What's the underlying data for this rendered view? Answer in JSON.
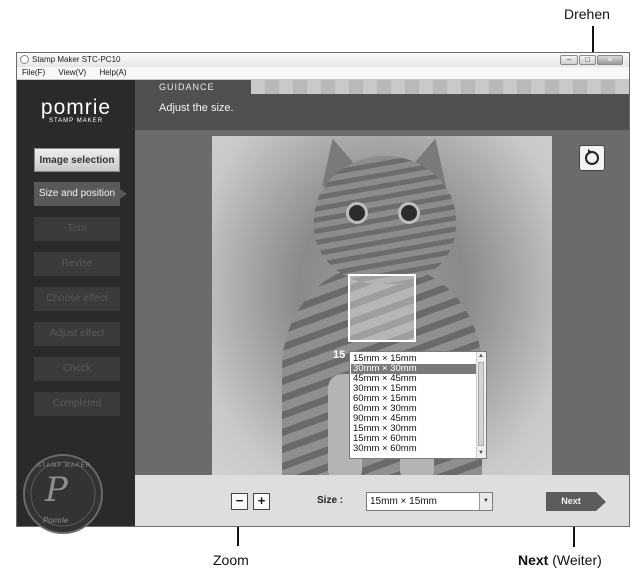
{
  "callouts": {
    "drehen": "Drehen",
    "zoom": "Zoom",
    "next_bold": "Next",
    "next_suffix": " (Weiter)"
  },
  "window": {
    "title": "Stamp Maker STC-PC10",
    "controls": [
      "–",
      "□",
      "×"
    ]
  },
  "menu": [
    "File(F)",
    "View(V)",
    "Help(A)"
  ],
  "logo": {
    "brand": "pomrie",
    "sub": "STAMP MAKER"
  },
  "steps": [
    {
      "label": "Image selection",
      "state": "done"
    },
    {
      "label": "Size and position",
      "state": "active"
    },
    {
      "label": "Trim",
      "state": "disabled"
    },
    {
      "label": "Revise",
      "state": "disabled"
    },
    {
      "label": "Choose effect",
      "state": "disabled"
    },
    {
      "label": "Adjust effect",
      "state": "disabled"
    },
    {
      "label": "Check",
      "state": "disabled"
    },
    {
      "label": "Completed",
      "state": "disabled"
    }
  ],
  "seal": {
    "top_text": "STAMP MAKER",
    "letter": "P",
    "bottom_text": "Pomrie"
  },
  "guidance": {
    "label": "GUIDANCE",
    "text": "Adjust the size."
  },
  "size_overlay": "15",
  "size_options": [
    "15mm × 15mm",
    "30mm × 30mm",
    "45mm × 45mm",
    "30mm × 15mm",
    "60mm × 15mm",
    "60mm × 30mm",
    "90mm × 45mm",
    "15mm × 30mm",
    "15mm × 60mm",
    "30mm × 60mm"
  ],
  "selected_option_index": 1,
  "bottom": {
    "zoom_out": "−",
    "zoom_in": "+",
    "size_label": "Size :",
    "size_value": "15mm × 15mm",
    "next_label": "Next"
  },
  "icons": {
    "rotate": "rotate-icon",
    "zoom_out": "minus-icon",
    "zoom_in": "plus-icon"
  }
}
